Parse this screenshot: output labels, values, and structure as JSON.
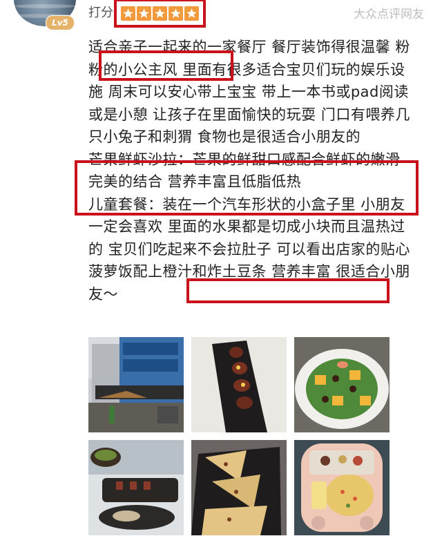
{
  "header": {
    "level_badge": "Lv5",
    "rating_label": "打分",
    "stars": 5,
    "source_tag": "大众点评网友"
  },
  "review": {
    "paragraph1": "适合亲子一起来的一家餐厅 餐厅装饰得很温馨 粉粉的小公主风 里面有很多适合宝贝们玩的娱乐设施 周末可以安心带上宝宝 带上一本书或pad阅读或是小憩 让孩子在里面愉快的玩耍 门口有喂养几只小兔子和刺猬 食物也是很适合小朋友的",
    "paragraph2": "芒果鲜虾沙拉：芒果的鲜甜口感配合鲜虾的嫩滑 完美的结合 营养丰富且低脂低热",
    "paragraph3": "儿童套餐：装在一个汽车形状的小盒子里 小朋友一定会喜欢 里面的水果都是切成小块而且温热过的 宝贝们吃起来不会拉肚子 可以看出店家的贴心 菠萝饭配上橙汁和炸土豆条 营养丰富 很适合小朋友～"
  },
  "colors": {
    "highlight_box": "#c8111a",
    "star": "#f29a3e",
    "level_badge": "#e5b26a"
  }
}
